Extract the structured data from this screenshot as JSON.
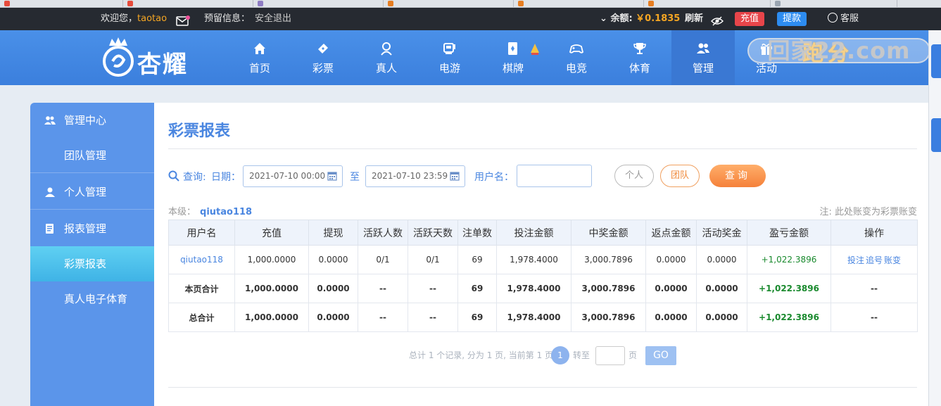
{
  "topbar": {
    "welcome": "欢迎您，",
    "username": "taotao",
    "reserve_label": "预留信息：",
    "logout": "安全退出",
    "balance_label": "余额:",
    "balance_value": "￥0.1835",
    "refresh": "刷新",
    "recharge": "充值",
    "withdraw": "提款",
    "service": "客服"
  },
  "logo": {
    "text": "杏耀"
  },
  "nav": {
    "home": "首页",
    "lottery": "彩票",
    "live": "真人",
    "egame": "电游",
    "chess": "棋牌",
    "esports": "电竞",
    "sports": "体育",
    "manage": "管理",
    "activity": "活动"
  },
  "watermark": {
    "top": "跑分",
    "domain": "回家22.com"
  },
  "sidebar": {
    "manage_center": "管理中心",
    "team_manage": "团队管理",
    "personal_manage": "个人管理",
    "report_manage": "报表管理",
    "lottery_report": "彩票报表",
    "live_egame_sports": "真人电子体育"
  },
  "page": {
    "title": "彩票报表",
    "query_label": "查询:",
    "date_label": "日期：",
    "date_start": "2021-07-10 00:00",
    "date_end": "2021-07-10 23:59",
    "to": "至",
    "username_label": "用户名：",
    "username_value": "",
    "btn_personal": "个人",
    "btn_team": "团队",
    "btn_query": "查询",
    "level_label": "本级：",
    "level_user": "qiutao118",
    "note": "注: 此处账变为彩票账变"
  },
  "table": {
    "headers": [
      "用户名",
      "充值",
      "提现",
      "活跃人数",
      "活跃天数",
      "注单数",
      "投注金额",
      "中奖金额",
      "返点金额",
      "活动奖金",
      "盈亏金额",
      "操作"
    ],
    "row1": [
      "qiutao118",
      "1,000.0000",
      "0.0000",
      "0/1",
      "0/1",
      "69",
      "1,978.4000",
      "3,000.7896",
      "0.0000",
      "0.0000",
      "+1,022.3896"
    ],
    "row1_ops": [
      "投注",
      "追号",
      "账变"
    ],
    "row2": [
      "本页合计",
      "1,000.0000",
      "0.0000",
      "--",
      "--",
      "69",
      "1,978.4000",
      "3,000.7896",
      "0.0000",
      "0.0000",
      "+1,022.3896",
      "--"
    ],
    "row3": [
      "总合计",
      "1,000.0000",
      "0.0000",
      "--",
      "--",
      "69",
      "1,978.4000",
      "3,000.7896",
      "0.0000",
      "0.0000",
      "+1,022.3896",
      "--"
    ]
  },
  "pager": {
    "summary": "总计 1 个记录, 分为 1 页, 当前第 1 页",
    "current": "1",
    "goto": "转至",
    "unit": "页",
    "go": "GO"
  },
  "colors": {
    "nav_blue": "#4a90e8",
    "sidebar_blue": "#5b95ea",
    "active_cyan": "#3fb3e6",
    "accent_orange": "#f5813a",
    "profit_green": "#1a8a2e",
    "topbar_dark": "#262a31"
  }
}
